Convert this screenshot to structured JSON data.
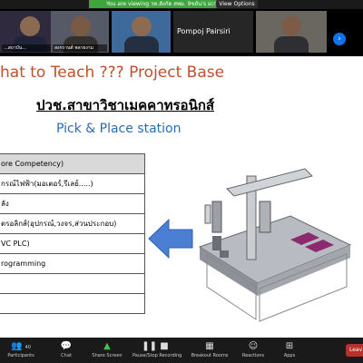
{
  "banner": {
    "viewing_text": "You are viewing วท.สังกัด สพม. 9ขยัน's screen",
    "view_options": "View Options"
  },
  "gallery": {
    "tiles": [
      {
        "name": "...สถาบัน..."
      },
      {
        "name": "สงกรานต์ พลายงาม"
      },
      {
        "name": ""
      },
      {
        "name": "Pompoj Pairsiri"
      },
      {
        "name": ""
      }
    ],
    "next_icon": "chevron-right-icon"
  },
  "slide": {
    "title": "hat to Teach ??? Project Base",
    "subtitle": "ปวช.สาขาวิชาเมคคาทรอนิกส์",
    "caption": "Pick & Place station",
    "table_rows": [
      "ore Competency)",
      "กรณ์ไฟฟ้า(มอเตอร์,รีเลย์.....)",
      "ลัง",
      "ตรอลิกส์(อุปกรณ์,วงจร,ส่วนประกอบ)",
      " VC PLC)",
      "rogramming",
      "",
      ""
    ],
    "colors": {
      "title": "#c0502a",
      "caption": "#2a6cb7",
      "arrow": "#4a7fd4"
    }
  },
  "toolbar": {
    "participants_label": "Participants",
    "participants_count": "40",
    "chat_label": "Chat",
    "share_label": "Share Screen",
    "record_label": "Pause/Stop Recording",
    "breakout_label": "Breakout Rooms",
    "reactions_label": "Reactions",
    "apps_label": "Apps",
    "leave_label": "Leav"
  }
}
